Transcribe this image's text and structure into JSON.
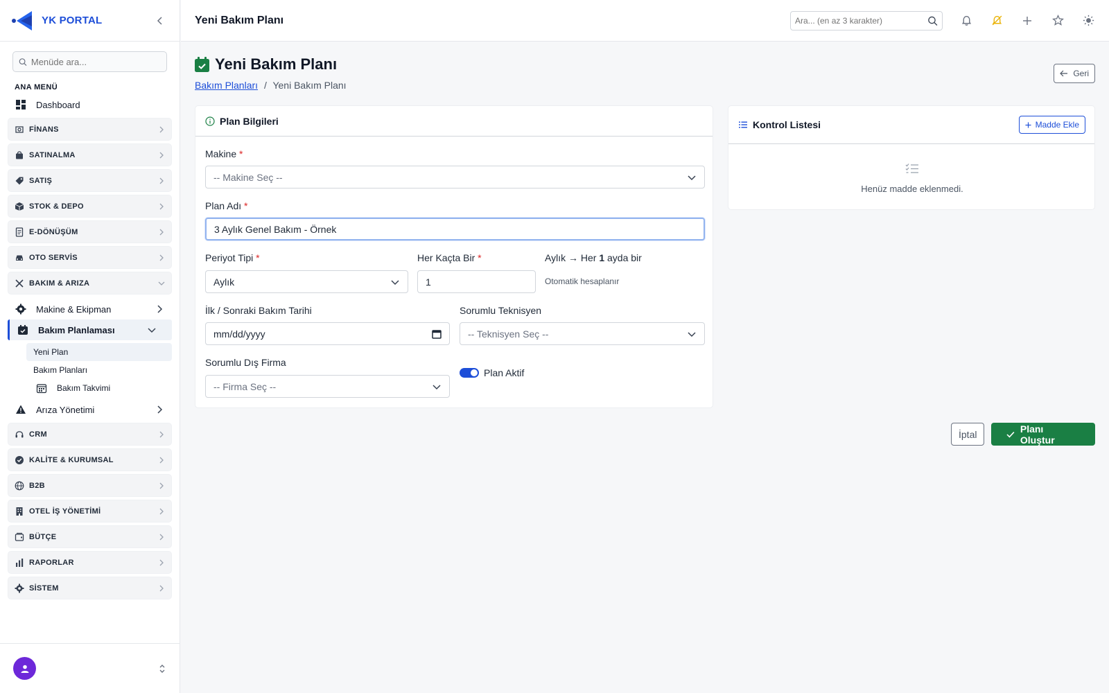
{
  "brand": {
    "name": "YK PORTAL"
  },
  "sidebar": {
    "search_placeholder": "Menüde ara...",
    "section_label": "ANA MENÜ",
    "dashboard": "Dashboard",
    "groups_top": [
      {
        "label": "FİNANS",
        "icon": "finance-icon"
      },
      {
        "label": "SATINALMA",
        "icon": "bag-icon"
      },
      {
        "label": "SATIŞ",
        "icon": "tag-icon"
      },
      {
        "label": "STOK & DEPO",
        "icon": "box-icon"
      },
      {
        "label": "E-DÖNÜŞÜM",
        "icon": "document-icon"
      },
      {
        "label": "OTO SERVİS",
        "icon": "car-icon"
      },
      {
        "label": "BAKIM & ARIZA",
        "icon": "tools-icon"
      }
    ],
    "maintenance_children": {
      "machine": "Makine & Ekipman",
      "planning": "Bakım Planlaması",
      "new_plan": "Yeni Plan",
      "plans": "Bakım Planları",
      "calendar": "Bakım Takvimi",
      "faults": "Arıza Yönetimi"
    },
    "groups_bottom": [
      {
        "label": "CRM",
        "icon": "headset-icon"
      },
      {
        "label": "KALİTE & KURUMSAL",
        "icon": "badge-icon"
      },
      {
        "label": "B2B",
        "icon": "globe-icon"
      },
      {
        "label": "OTEL İŞ YÖNETİMİ",
        "icon": "building-icon"
      },
      {
        "label": "BÜTÇE",
        "icon": "wallet-icon"
      },
      {
        "label": "RAPORLAR",
        "icon": "bar-chart-icon"
      },
      {
        "label": "SİSTEM",
        "icon": "gear-icon"
      }
    ]
  },
  "topbar": {
    "title": "Yeni Bakım Planı",
    "search_placeholder": "Ara... (en az 3 karakter)"
  },
  "page": {
    "title": "Yeni Bakım Planı",
    "breadcrumb_link": "Bakım Planları",
    "breadcrumb_sep": "/",
    "breadcrumb_current": "Yeni Bakım Planı",
    "back_label": "Geri"
  },
  "plan_form": {
    "header": "Plan Bilgileri",
    "machine_label": "Makine",
    "machine_placeholder": "-- Makine Seç --",
    "plan_name_label": "Plan Adı",
    "plan_name_value": "3 Aylık Genel Bakım - Örnek",
    "period_type_label": "Periyot Tipi",
    "period_type_value": "Aylık",
    "every_label": "Her Kaçta Bir",
    "every_value": "1",
    "summary_prefix": "Aylık → Her",
    "summary_number": "1",
    "summary_suffix": "ayda bir",
    "summary_hint": "Otomatik hesaplanır",
    "date_label": "İlk / Sonraki Bakım Tarihi",
    "date_placeholder": "mm/dd/yyyy",
    "technician_label": "Sorumlu Teknisyen",
    "technician_placeholder": "-- Teknisyen Seç --",
    "firm_label": "Sorumlu Dış Firma",
    "firm_placeholder": "-- Firma Seç --",
    "active_label": "Plan Aktif",
    "active": true,
    "required_mark": "*"
  },
  "checklist": {
    "header": "Kontrol Listesi",
    "add_label": "Madde Ekle",
    "empty_text": "Henüz madde eklenmedi."
  },
  "actions": {
    "cancel": "İptal",
    "submit": "Planı Oluştur"
  },
  "colors": {
    "primary": "#1d4ed8",
    "success": "#1a7f44",
    "required": "#dc2626",
    "avatar": "#6d28d9"
  }
}
